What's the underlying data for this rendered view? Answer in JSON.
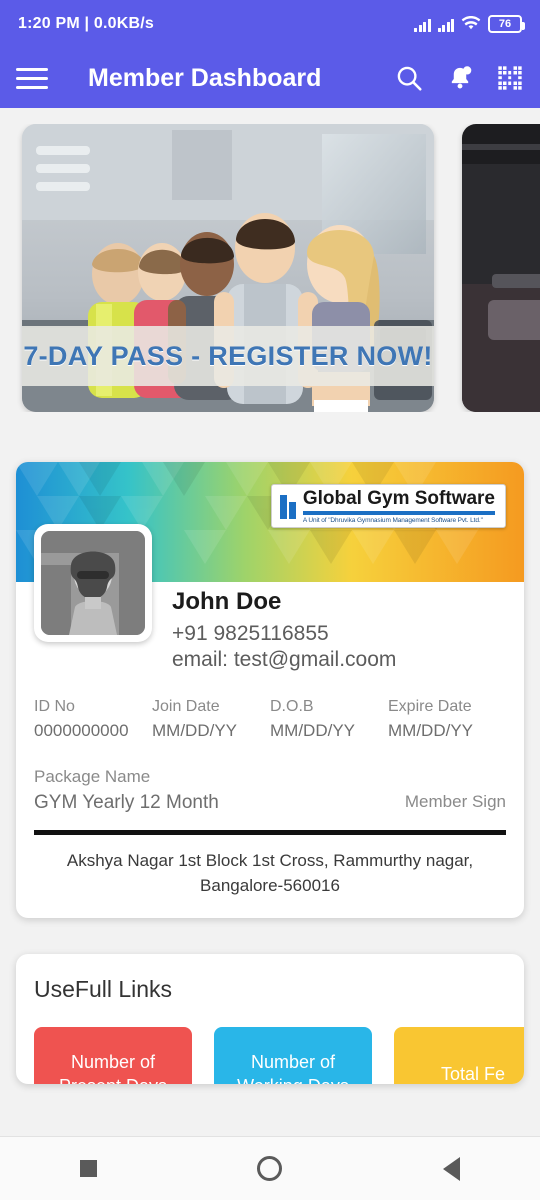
{
  "status_bar": {
    "time": "1:20 PM",
    "separator": "|",
    "network_speed": "0.0KB/s",
    "battery_level": "76",
    "icons": [
      "signal-icon",
      "signal-icon",
      "wifi-icon",
      "battery-icon"
    ]
  },
  "app_bar": {
    "title": "Member Dashboard",
    "menu_icon": "hamburger-menu-icon",
    "actions": [
      "search-icon",
      "notification-bell-icon",
      "qr-code-scanner-icon"
    ]
  },
  "carousel": {
    "slides": [
      {
        "promo_text": "7-DAY PASS - REGISTER NOW!",
        "alt": "gym-members-photo"
      },
      {
        "promo_text": "",
        "alt": "gym-interior-photo"
      }
    ]
  },
  "id_card": {
    "brand": {
      "name": "Global Gym Software",
      "tagline": "A Unit of \"Dhruvika Gymnasium Management Software Pvt. Ltd.\""
    },
    "avatar_alt": "member-profile-photo",
    "member": {
      "name": "John Doe",
      "phone": "+91 9825116855",
      "email": "email: test@gmail.coom"
    },
    "fields": [
      {
        "label": "ID No",
        "value": "0000000000"
      },
      {
        "label": "Join Date",
        "value": "MM/DD/YY"
      },
      {
        "label": "D.O.B",
        "value": "MM/DD/YY"
      },
      {
        "label": "Expire Date",
        "value": "MM/DD/YY"
      }
    ],
    "package": {
      "label": "Package Name",
      "value": "GYM Yearly 12 Month"
    },
    "member_sign_label": "Member Sign",
    "address": "Akshya Nagar 1st Block 1st Cross, Rammurthy nagar, Bangalore-560016"
  },
  "useful_links": {
    "title": "UseFull Links",
    "chips": [
      {
        "label": "Number of Present Days",
        "color": "#ef5350"
      },
      {
        "label": "Number of Working Days",
        "color": "#29b6e8"
      },
      {
        "label": "Total Fe",
        "color": "#f9c632"
      }
    ]
  },
  "nav_bar": {
    "buttons": [
      "recents-square-icon",
      "home-circle-icon",
      "back-triangle-icon"
    ]
  },
  "colors": {
    "primary": "#5b5be8",
    "card_bg": "#ffffff",
    "page_bg": "#f2f2f2"
  }
}
